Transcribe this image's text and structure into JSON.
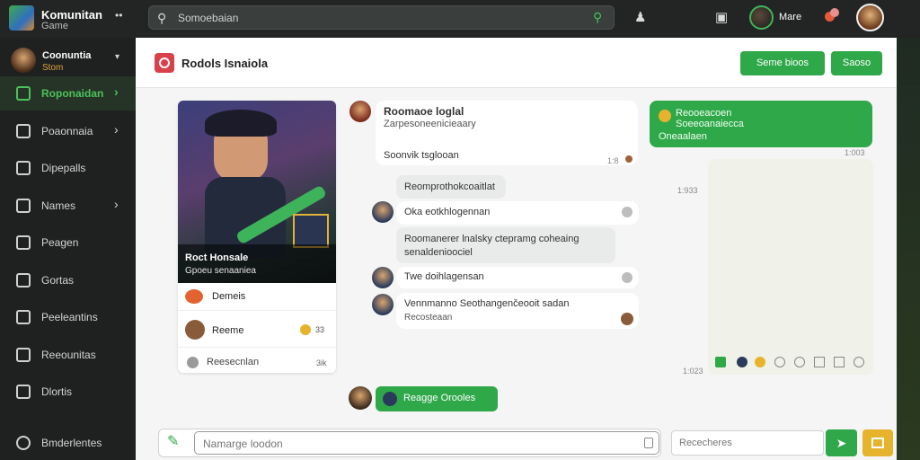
{
  "app": {
    "name": "Komunitan",
    "subtitle": "Game"
  },
  "search": {
    "value": "Somoebaian"
  },
  "topbar": {
    "user_name": "Mare"
  },
  "sidebar": {
    "profile": {
      "name": "Coonuntia",
      "status": "Stom"
    },
    "items": [
      {
        "label": "Roponaidan",
        "active": true,
        "chevron": true
      },
      {
        "label": "Poaonnaia",
        "chevron": true
      },
      {
        "label": "Dipepalls"
      },
      {
        "label": "Names",
        "chevron": true
      },
      {
        "label": "Peagen"
      },
      {
        "label": "Gortas"
      },
      {
        "label": "Peeleantins"
      },
      {
        "label": "Reeounitas"
      },
      {
        "label": "Dlortis"
      }
    ],
    "bottom_item": "Bmderlentes"
  },
  "header": {
    "title": "Rodols Isnaiola",
    "buttons": [
      "Seme bioos",
      "Saoso"
    ]
  },
  "card": {
    "overlay_title": "Roct Honsale",
    "overlay_sub": "Gpoeu senaaniea",
    "rows": [
      {
        "label": "Demeis"
      },
      {
        "label": "Reeme",
        "badge": "33"
      },
      {
        "label": "Reesecnlan",
        "meta": "3ik"
      }
    ]
  },
  "chat": {
    "messages": [
      {
        "title": "Roomaoe loglal",
        "sub": "Zarpesoneenicieaary",
        "foot": "Soonvik tsglooan",
        "time": "1:8"
      },
      {
        "text": "Reomprothokcoaitlat"
      },
      {
        "text": "Oka eotkhlogennan"
      },
      {
        "text": "Roomanerer lnalsky ctepramg coheaing senaldenioociel"
      },
      {
        "text": "Twe doihlagensan"
      },
      {
        "text": "Vennmanno Seothangenčeooit sadan",
        "sub": "Recosteaan"
      },
      {
        "reply": "Reagge Orooles"
      }
    ],
    "right_bubble": {
      "line1": "Reooeacoen",
      "line2": "Soeeoanaiecca",
      "line3": "Oneaalaen"
    },
    "times": [
      "1:003",
      "1:933",
      "1:023"
    ]
  },
  "compose": {
    "placeholder": "Namarge loodon",
    "placeholder2": "Rececheres"
  },
  "colors": {
    "accent": "#2fa84a",
    "sidebar_bg": "#1e2120",
    "topbar_bg": "#222524"
  }
}
